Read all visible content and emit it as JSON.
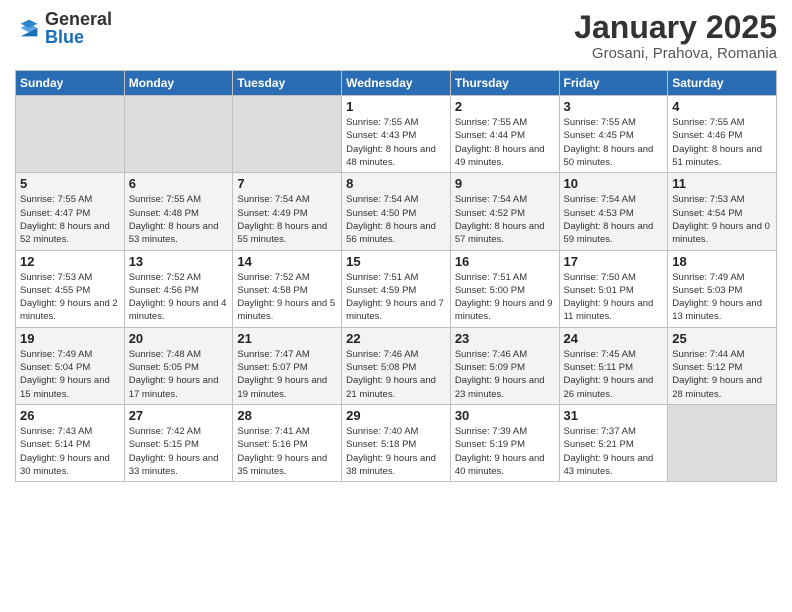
{
  "logo": {
    "general": "General",
    "blue": "Blue"
  },
  "title": "January 2025",
  "location": "Grosani, Prahova, Romania",
  "days_of_week": [
    "Sunday",
    "Monday",
    "Tuesday",
    "Wednesday",
    "Thursday",
    "Friday",
    "Saturday"
  ],
  "weeks": [
    [
      {
        "day": "",
        "info": ""
      },
      {
        "day": "",
        "info": ""
      },
      {
        "day": "",
        "info": ""
      },
      {
        "day": "1",
        "info": "Sunrise: 7:55 AM\nSunset: 4:43 PM\nDaylight: 8 hours\nand 48 minutes."
      },
      {
        "day": "2",
        "info": "Sunrise: 7:55 AM\nSunset: 4:44 PM\nDaylight: 8 hours\nand 49 minutes."
      },
      {
        "day": "3",
        "info": "Sunrise: 7:55 AM\nSunset: 4:45 PM\nDaylight: 8 hours\nand 50 minutes."
      },
      {
        "day": "4",
        "info": "Sunrise: 7:55 AM\nSunset: 4:46 PM\nDaylight: 8 hours\nand 51 minutes."
      }
    ],
    [
      {
        "day": "5",
        "info": "Sunrise: 7:55 AM\nSunset: 4:47 PM\nDaylight: 8 hours\nand 52 minutes."
      },
      {
        "day": "6",
        "info": "Sunrise: 7:55 AM\nSunset: 4:48 PM\nDaylight: 8 hours\nand 53 minutes."
      },
      {
        "day": "7",
        "info": "Sunrise: 7:54 AM\nSunset: 4:49 PM\nDaylight: 8 hours\nand 55 minutes."
      },
      {
        "day": "8",
        "info": "Sunrise: 7:54 AM\nSunset: 4:50 PM\nDaylight: 8 hours\nand 56 minutes."
      },
      {
        "day": "9",
        "info": "Sunrise: 7:54 AM\nSunset: 4:52 PM\nDaylight: 8 hours\nand 57 minutes."
      },
      {
        "day": "10",
        "info": "Sunrise: 7:54 AM\nSunset: 4:53 PM\nDaylight: 8 hours\nand 59 minutes."
      },
      {
        "day": "11",
        "info": "Sunrise: 7:53 AM\nSunset: 4:54 PM\nDaylight: 9 hours\nand 0 minutes."
      }
    ],
    [
      {
        "day": "12",
        "info": "Sunrise: 7:53 AM\nSunset: 4:55 PM\nDaylight: 9 hours\nand 2 minutes."
      },
      {
        "day": "13",
        "info": "Sunrise: 7:52 AM\nSunset: 4:56 PM\nDaylight: 9 hours\nand 4 minutes."
      },
      {
        "day": "14",
        "info": "Sunrise: 7:52 AM\nSunset: 4:58 PM\nDaylight: 9 hours\nand 5 minutes."
      },
      {
        "day": "15",
        "info": "Sunrise: 7:51 AM\nSunset: 4:59 PM\nDaylight: 9 hours\nand 7 minutes."
      },
      {
        "day": "16",
        "info": "Sunrise: 7:51 AM\nSunset: 5:00 PM\nDaylight: 9 hours\nand 9 minutes."
      },
      {
        "day": "17",
        "info": "Sunrise: 7:50 AM\nSunset: 5:01 PM\nDaylight: 9 hours\nand 11 minutes."
      },
      {
        "day": "18",
        "info": "Sunrise: 7:49 AM\nSunset: 5:03 PM\nDaylight: 9 hours\nand 13 minutes."
      }
    ],
    [
      {
        "day": "19",
        "info": "Sunrise: 7:49 AM\nSunset: 5:04 PM\nDaylight: 9 hours\nand 15 minutes."
      },
      {
        "day": "20",
        "info": "Sunrise: 7:48 AM\nSunset: 5:05 PM\nDaylight: 9 hours\nand 17 minutes."
      },
      {
        "day": "21",
        "info": "Sunrise: 7:47 AM\nSunset: 5:07 PM\nDaylight: 9 hours\nand 19 minutes."
      },
      {
        "day": "22",
        "info": "Sunrise: 7:46 AM\nSunset: 5:08 PM\nDaylight: 9 hours\nand 21 minutes."
      },
      {
        "day": "23",
        "info": "Sunrise: 7:46 AM\nSunset: 5:09 PM\nDaylight: 9 hours\nand 23 minutes."
      },
      {
        "day": "24",
        "info": "Sunrise: 7:45 AM\nSunset: 5:11 PM\nDaylight: 9 hours\nand 26 minutes."
      },
      {
        "day": "25",
        "info": "Sunrise: 7:44 AM\nSunset: 5:12 PM\nDaylight: 9 hours\nand 28 minutes."
      }
    ],
    [
      {
        "day": "26",
        "info": "Sunrise: 7:43 AM\nSunset: 5:14 PM\nDaylight: 9 hours\nand 30 minutes."
      },
      {
        "day": "27",
        "info": "Sunrise: 7:42 AM\nSunset: 5:15 PM\nDaylight: 9 hours\nand 33 minutes."
      },
      {
        "day": "28",
        "info": "Sunrise: 7:41 AM\nSunset: 5:16 PM\nDaylight: 9 hours\nand 35 minutes."
      },
      {
        "day": "29",
        "info": "Sunrise: 7:40 AM\nSunset: 5:18 PM\nDaylight: 9 hours\nand 38 minutes."
      },
      {
        "day": "30",
        "info": "Sunrise: 7:39 AM\nSunset: 5:19 PM\nDaylight: 9 hours\nand 40 minutes."
      },
      {
        "day": "31",
        "info": "Sunrise: 7:37 AM\nSunset: 5:21 PM\nDaylight: 9 hours\nand 43 minutes."
      },
      {
        "day": "",
        "info": ""
      }
    ]
  ]
}
